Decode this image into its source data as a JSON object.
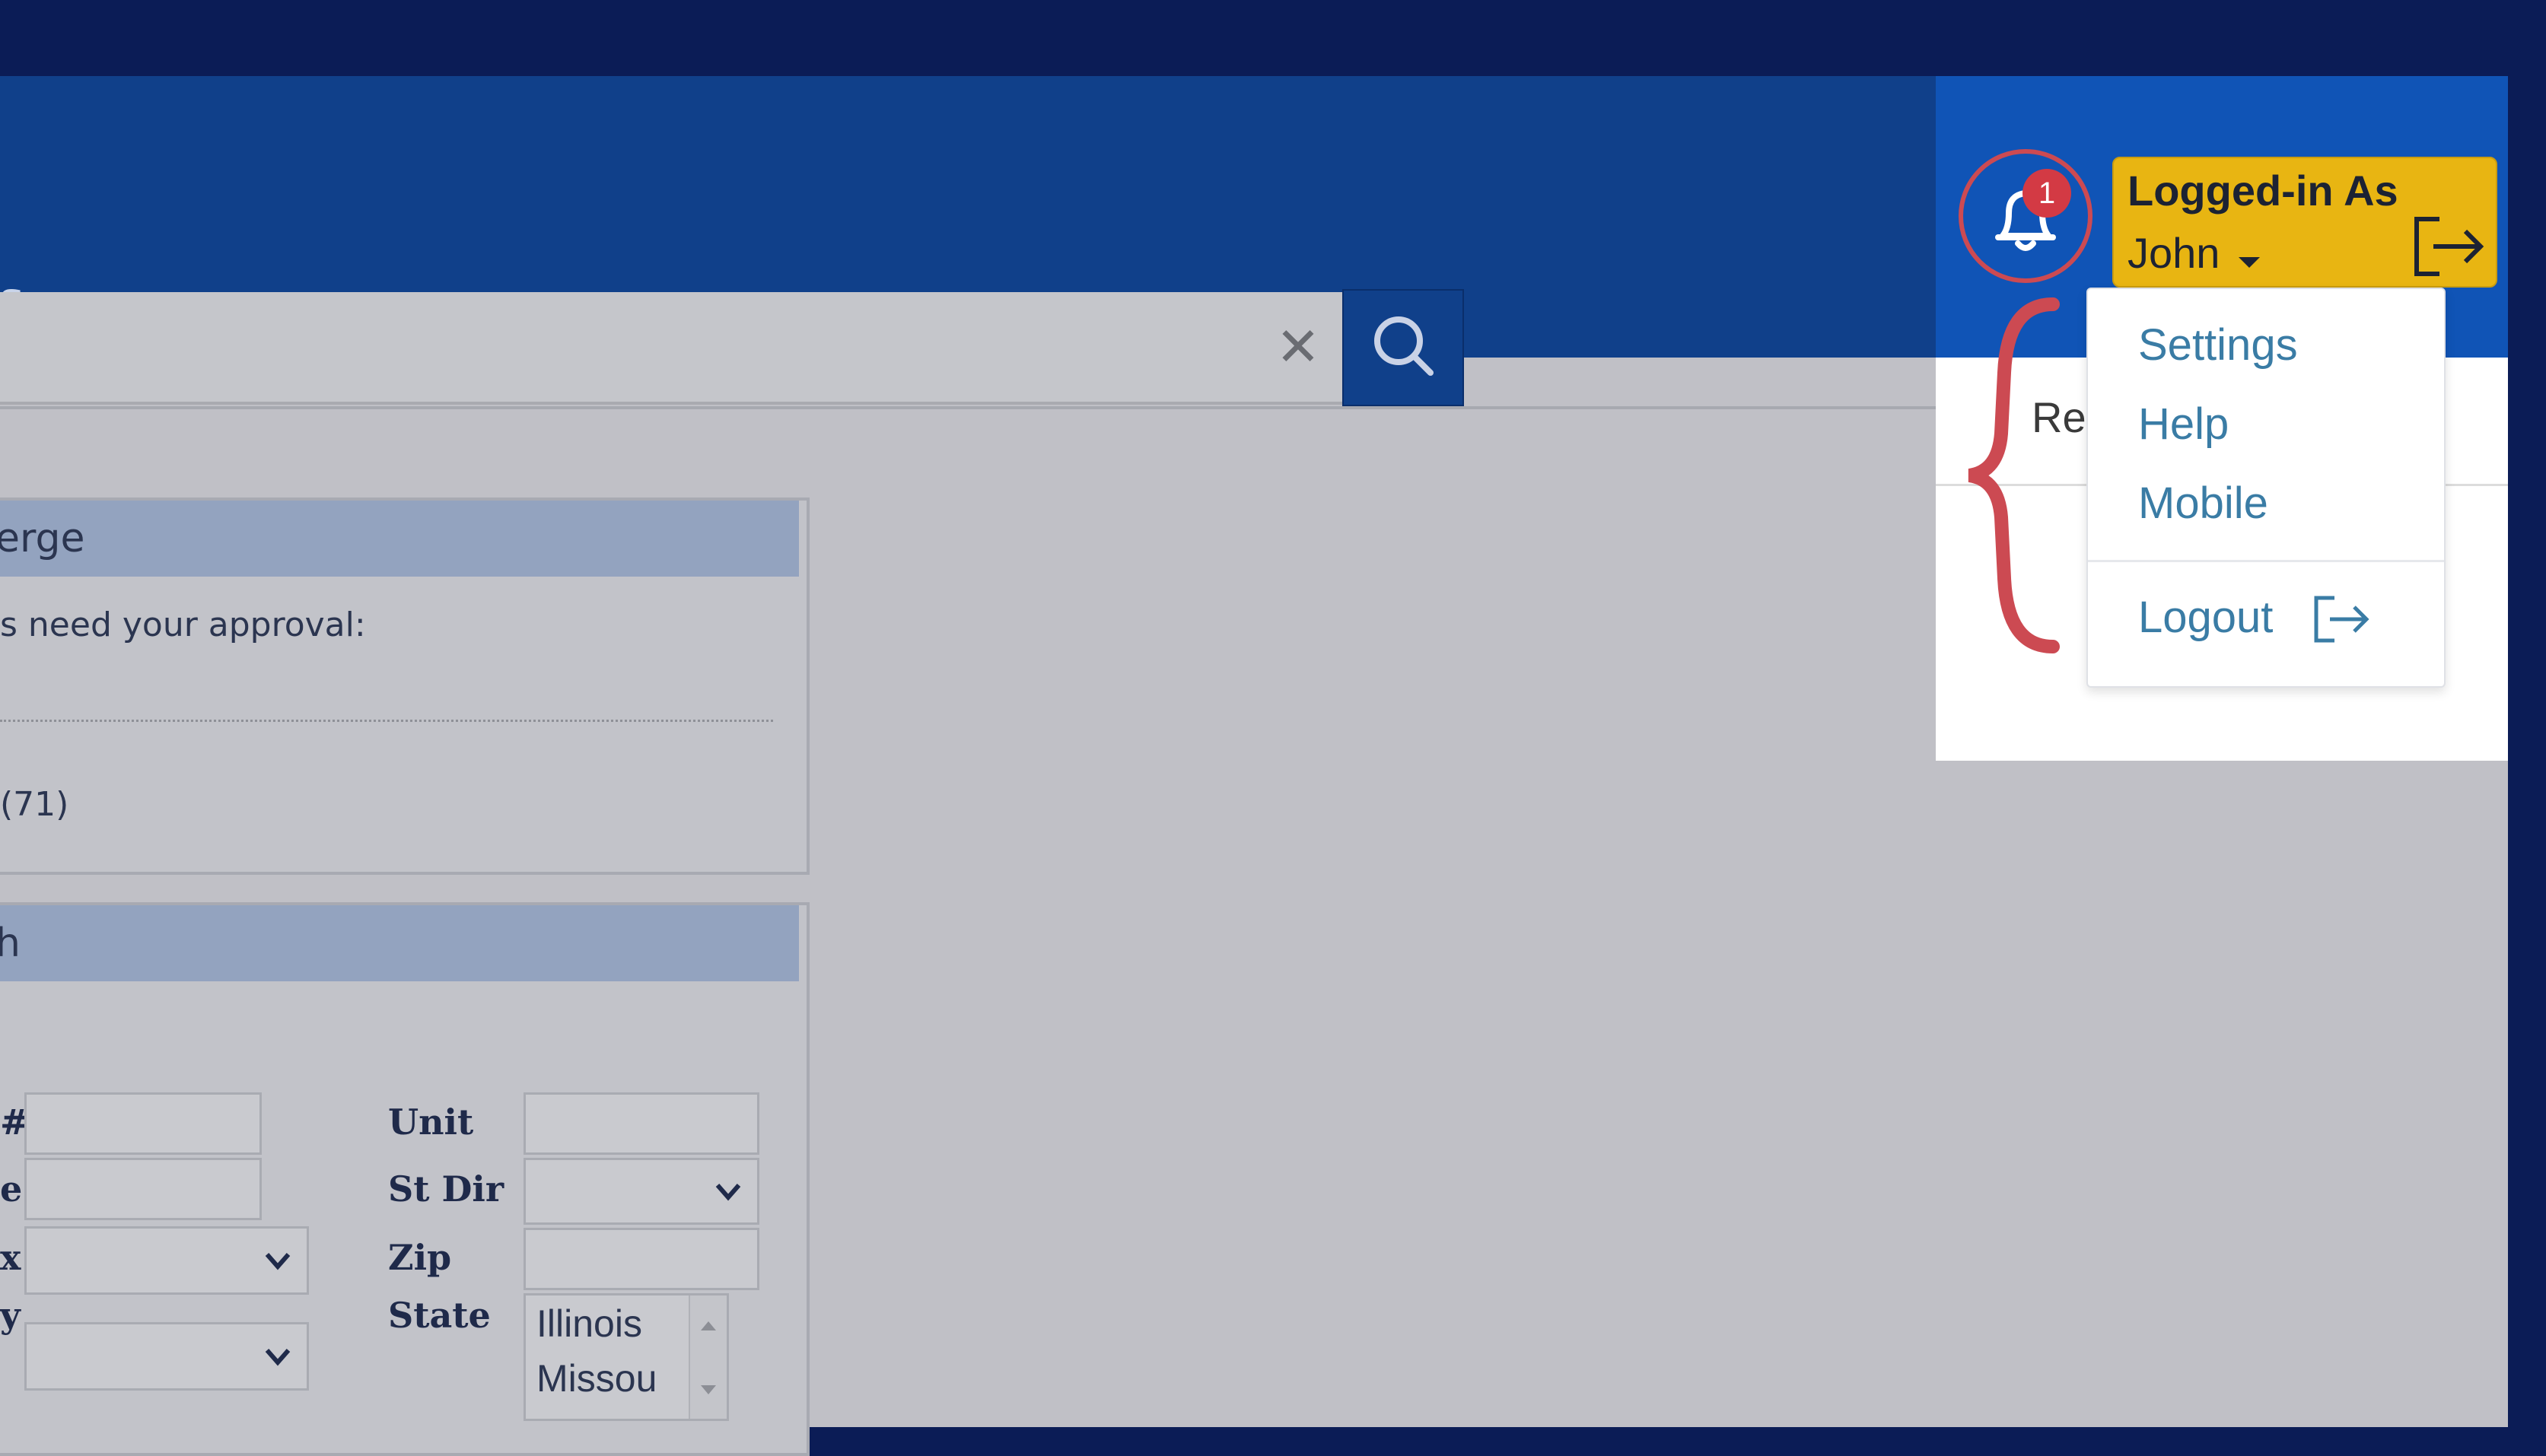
{
  "colors": {
    "page_background": "#0b1c56",
    "navbar": "#10408a",
    "user_button": "#e8b512",
    "badge": "#d33a44",
    "highlight": "#cc4a52",
    "menu_link": "#3a7ca5"
  },
  "navbar": {
    "partial_label": "s"
  },
  "search": {
    "clear_icon": "close-icon",
    "button_icon": "search-icon"
  },
  "panels": {
    "approvals": {
      "header": "erge",
      "text": "s need your approval:",
      "count": "(71)"
    },
    "search": {
      "header": "h",
      "left_labels": [
        "#",
        "e",
        "x",
        "y"
      ],
      "unit_label": "Unit",
      "st_dir_label": "St Dir",
      "zip_label": "Zip",
      "state_label": "State",
      "state_options": [
        "Illinois",
        "Missou"
      ]
    }
  },
  "header": {
    "notifications": {
      "icon": "bell-icon",
      "count": "1"
    },
    "user": {
      "title": "Logged-in As",
      "name": "John",
      "exit_icon": "logout-arrow-icon"
    }
  },
  "partial_tab": "Re",
  "user_menu": {
    "items": [
      "Settings",
      "Help",
      "Mobile"
    ],
    "logout": "Logout"
  }
}
